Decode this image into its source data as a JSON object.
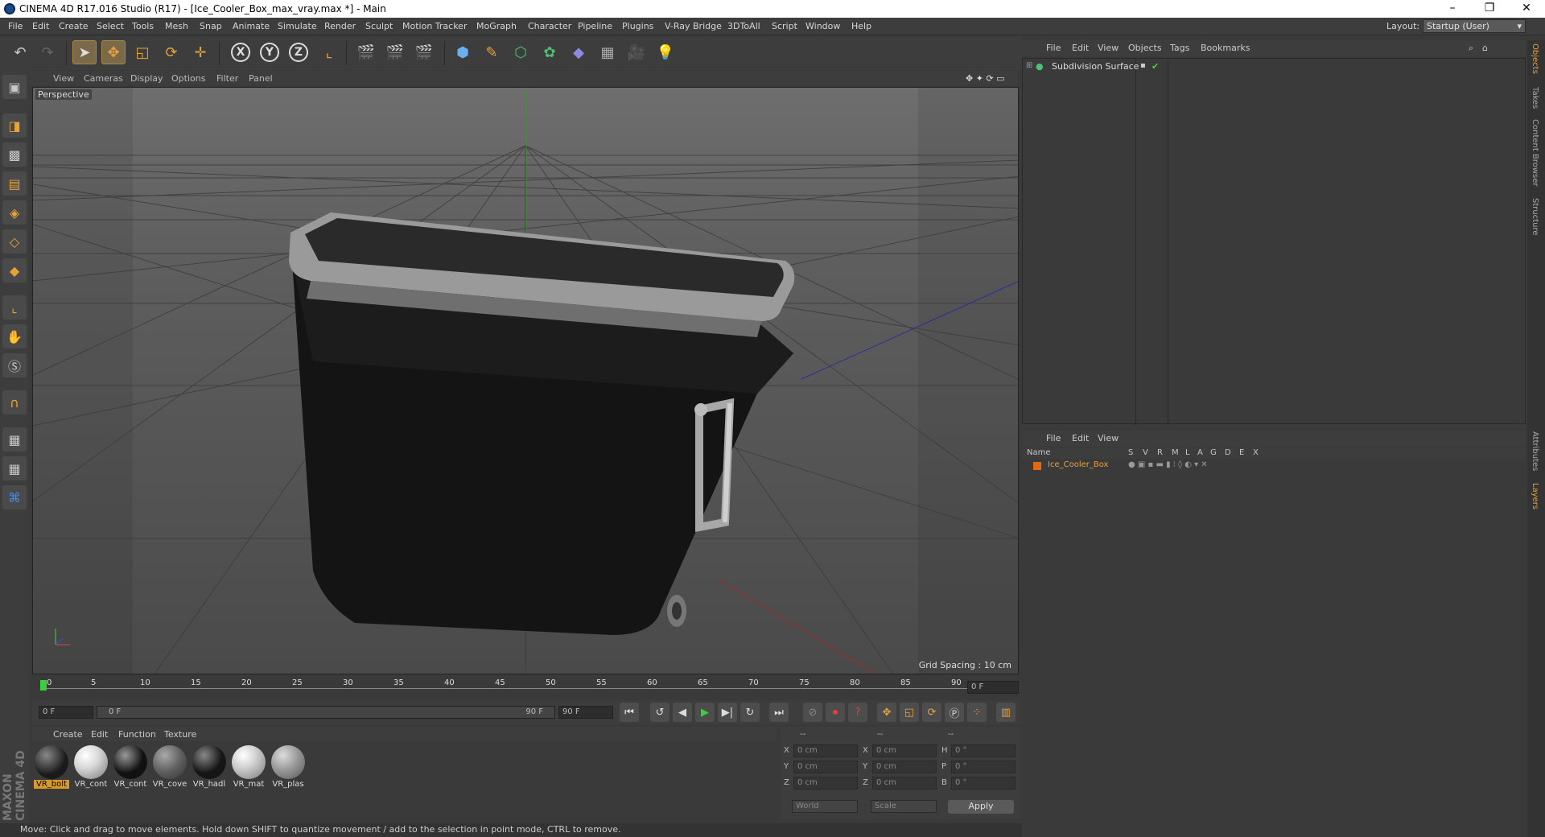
{
  "window": {
    "title": "CINEMA 4D R17.016 Studio (R17) - [Ice_Cooler_Box_max_vray.max *] - Main",
    "controls": [
      "–",
      "❐",
      "✕"
    ]
  },
  "menubar": {
    "items": [
      "File",
      "Edit",
      "Create",
      "Select",
      "Tools",
      "Mesh",
      "Snap",
      "Animate",
      "Simulate",
      "Render",
      "Sculpt",
      "Motion Tracker",
      "MoGraph",
      "Character",
      "Pipeline",
      "Plugins",
      "V-Ray Bridge",
      "3DToAll",
      "Script",
      "Window",
      "Help"
    ],
    "layout_label": "Layout:",
    "layout_value": "Startup (User)"
  },
  "viewport": {
    "menu": [
      "View",
      "Cameras",
      "Display",
      "Options",
      "Filter",
      "Panel"
    ],
    "camera": "Perspective",
    "grid_spacing": "Grid Spacing : 10 cm"
  },
  "timeline": {
    "ticks": [
      "0",
      "5",
      "10",
      "15",
      "20",
      "25",
      "30",
      "35",
      "40",
      "45",
      "50",
      "55",
      "60",
      "65",
      "70",
      "75",
      "80",
      "85",
      "90"
    ],
    "current_frame_display": "0 F",
    "start_field": "0 F",
    "range_start": "0 F",
    "range_end": "90 F",
    "end_field": "90 F"
  },
  "materials": {
    "menu": [
      "Create",
      "Edit",
      "Function",
      "Texture"
    ],
    "items": [
      {
        "label": "VR_bolt",
        "color": "#1a1a1a"
      },
      {
        "label": "VR_cont",
        "color": "#d8d8d8"
      },
      {
        "label": "VR_cont",
        "color": "#111111"
      },
      {
        "label": "VR_cove",
        "color": "#606060"
      },
      {
        "label": "VR_hadl",
        "color": "#151515"
      },
      {
        "label": "VR_mat",
        "color": "#cfcfcf"
      },
      {
        "label": "VR_plas",
        "color": "#9a9a9a"
      }
    ]
  },
  "coordinates": {
    "headers": [
      "--",
      "--",
      "--"
    ],
    "rows": [
      {
        "a": "X",
        "av": "0 cm",
        "b": "X",
        "bv": "0 cm",
        "c": "H",
        "cv": "0 °"
      },
      {
        "a": "Y",
        "av": "0 cm",
        "b": "Y",
        "bv": "0 cm",
        "c": "P",
        "cv": "0 °"
      },
      {
        "a": "Z",
        "av": "0 cm",
        "b": "Z",
        "bv": "0 cm",
        "c": "B",
        "cv": "0 °"
      }
    ],
    "world": "World",
    "scale": "Scale",
    "apply": "Apply"
  },
  "status": "Move: Click and drag to move elements. Hold down SHIFT to quantize movement / add to the selection in point mode, CTRL to remove.",
  "objects": {
    "menu": [
      "File",
      "Edit",
      "View",
      "Objects",
      "Tags",
      "Bookmarks"
    ],
    "items": [
      {
        "name": "Subdivision Surface"
      }
    ]
  },
  "layers": {
    "menu": [
      "File",
      "Edit",
      "View"
    ],
    "columns": [
      "Name",
      "S",
      "V",
      "R",
      "M",
      "L",
      "A",
      "G",
      "D",
      "E",
      "X"
    ],
    "items": [
      {
        "name": "Ice_Cooler_Box",
        "color": "#e06a1a"
      }
    ]
  },
  "side_tabs": [
    "Objects",
    "Takes",
    "Content Browser",
    "Structure",
    "Attributes",
    "Layers"
  ],
  "brand": "MAXON CINEMA 4D"
}
